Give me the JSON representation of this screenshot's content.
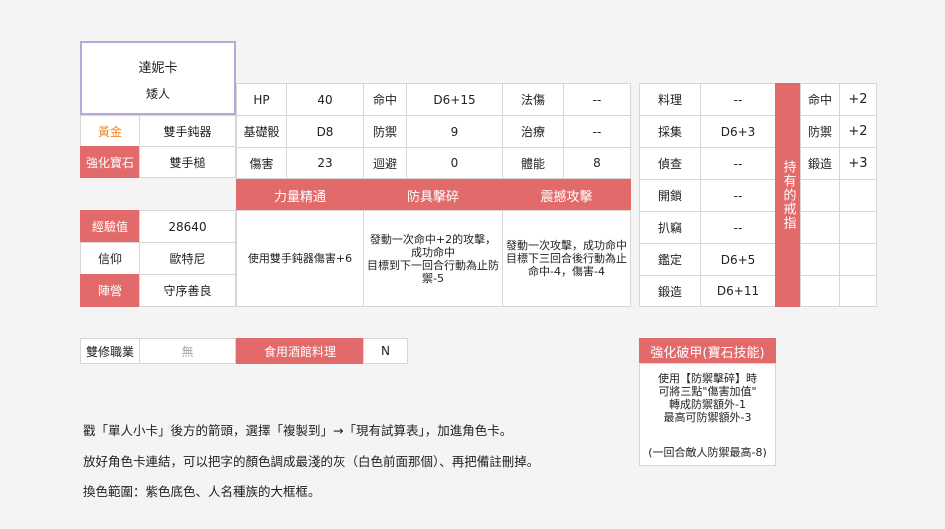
{
  "card": {
    "name": "達妮卡",
    "race": "矮人"
  },
  "profile": [
    {
      "label": "黃金",
      "value": "雙手鈍器"
    },
    {
      "label": "強化寶石",
      "value": "雙手槌"
    }
  ],
  "exp": [
    {
      "label": "經驗值",
      "value": "28640"
    },
    {
      "label": "信仰",
      "value": "歐特尼"
    },
    {
      "label": "陣營",
      "value": "守序善良"
    }
  ],
  "stats": [
    [
      "HP",
      "40",
      "命中",
      "D6+15",
      "法傷",
      "--"
    ],
    [
      "基礎骰",
      "D8",
      "防禦",
      "9",
      "治療",
      "--"
    ],
    [
      "傷害",
      "23",
      "迴避",
      "0",
      "體能",
      "8"
    ]
  ],
  "skills": [
    {
      "name": "力量精通",
      "desc": "使用雙手鈍器傷害+6"
    },
    {
      "name": "防具擊碎",
      "desc": "發動一次命中+2的攻擊，成功命中\n目標到下一回合行動為止防禦-5"
    },
    {
      "name": "震撼攻擊",
      "desc": "發動一次攻擊，成功命中\n目標下三回合後行動為止\n命中-4，傷害-4"
    }
  ],
  "crafts": [
    {
      "label": "料理",
      "value": "--"
    },
    {
      "label": "採集",
      "value": "D6+3"
    },
    {
      "label": "偵查",
      "value": "--"
    },
    {
      "label": "開鎖",
      "value": "--"
    },
    {
      "label": "扒竊",
      "value": "--"
    },
    {
      "label": "鑑定",
      "value": "D6+5"
    },
    {
      "label": "鍛造",
      "value": "D6+11"
    }
  ],
  "ring": {
    "title": "持有的戒指",
    "bonuses": [
      {
        "label": "命中",
        "value": "+2"
      },
      {
        "label": "防禦",
        "value": "+2"
      },
      {
        "label": "鍛造",
        "value": "+3"
      }
    ]
  },
  "bottom": {
    "multiclass_label": "雙修職業",
    "multiclass_value": "無",
    "tavern_label": "食用酒館料理",
    "tavern_value": "N"
  },
  "gem_skill": {
    "title": "強化破甲(寶石技能)",
    "desc": "使用【防禦擊碎】時\n可將三點\"傷害加值\"\n轉成防禦額外-1\n最高可防禦額外-3",
    "note": "(一回合敵人防禦最高-8)"
  },
  "notes": [
    "戳「單人小卡」後方的箭頭，選擇「複製到」→「現有試算表」，加進角色卡。",
    "放好角色卡連結，可以把字的顏色調成最淺的灰（白色前面那個）、再把備註刪掉。",
    "換色範圍：紫色底色、人名種族的大框框。"
  ]
}
